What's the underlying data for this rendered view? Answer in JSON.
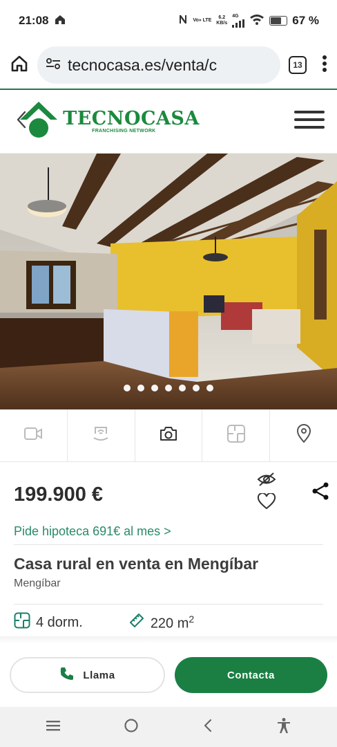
{
  "status": {
    "time": "21:08",
    "net_type": "Vo» LTE",
    "speed_value": "6.2",
    "speed_unit": "KB/s",
    "signal_label": "4G",
    "battery": "67 %"
  },
  "browser": {
    "url": "tecnocasa.es/venta/c",
    "tab_count": "13"
  },
  "site": {
    "logo_name": "TECNOCASA",
    "logo_sub": "FRANCHISING NETWORK"
  },
  "gallery": {
    "dot_count": 7,
    "colors": {
      "wall": "#e8c02e",
      "floor": "#7a5234",
      "ceiling": "#e6e2da",
      "beam": "#4a2f1a"
    }
  },
  "media_tabs": [
    {
      "icon": "video-icon"
    },
    {
      "icon": "virtual-tour-icon"
    },
    {
      "icon": "camera-icon"
    },
    {
      "icon": "floorplan-icon"
    },
    {
      "icon": "location-pin-icon"
    }
  ],
  "listing": {
    "price": "199.900 €",
    "mortgage": "Pide hipoteca 691€ al mes >",
    "title": "Casa rural en venta en Mengíbar",
    "location": "Mengíbar",
    "bedrooms": "4 dorm.",
    "area": "220 m",
    "area_sup": "2"
  },
  "actions": {
    "call_label": "Llama",
    "contact_label": "Contacta"
  },
  "theme": {
    "brand_green": "#1b7f44",
    "link_green": "#2a8a6a"
  }
}
